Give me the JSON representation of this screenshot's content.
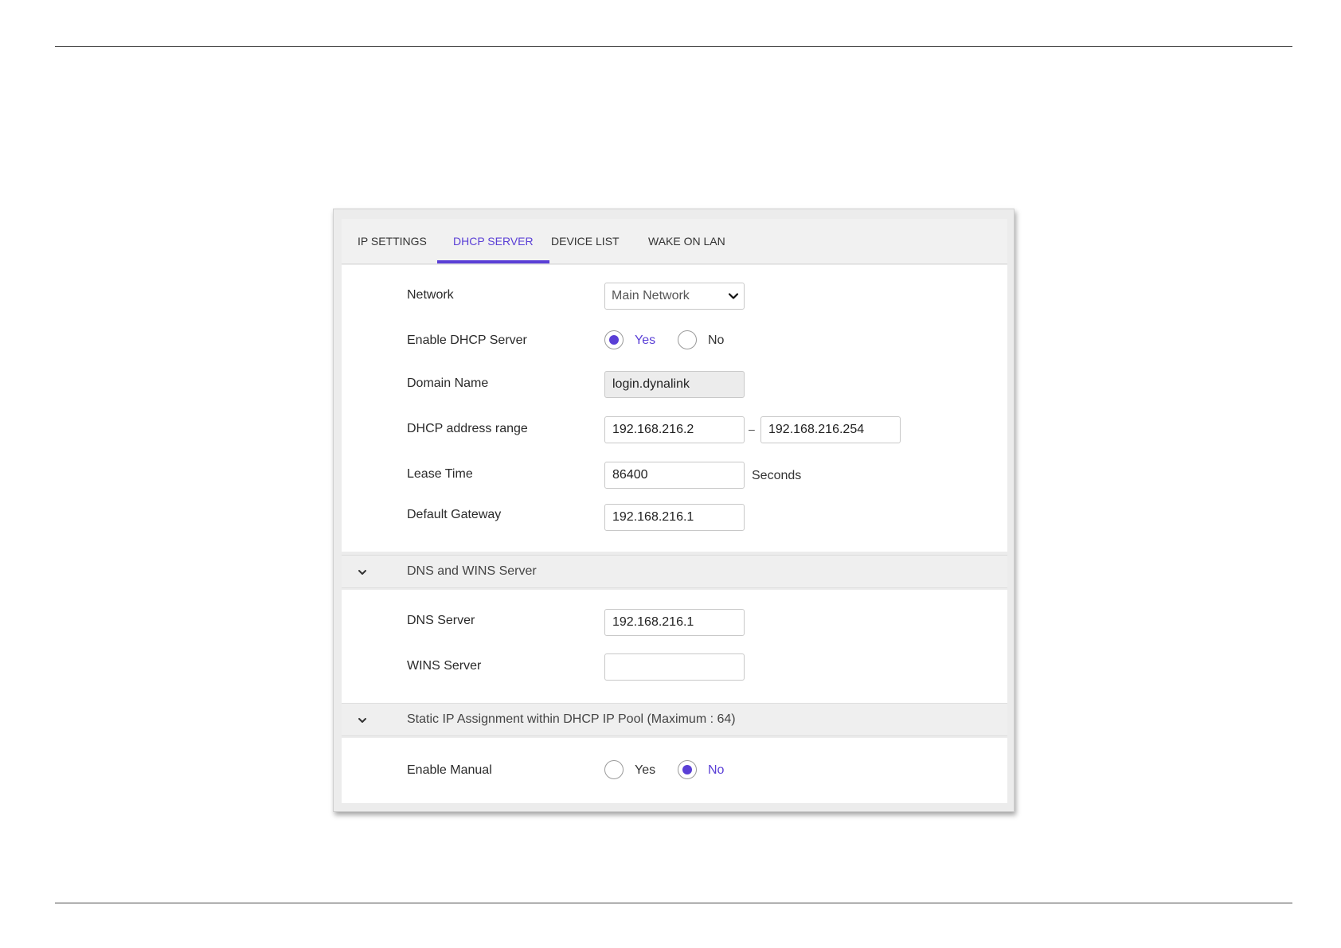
{
  "accent_color": "#5a3fd6",
  "tabs": [
    {
      "label": "IP SETTINGS",
      "active": false
    },
    {
      "label": "DHCP SERVER",
      "active": true
    },
    {
      "label": "DEVICE LIST",
      "active": false
    },
    {
      "label": "WAKE ON LAN",
      "active": false
    }
  ],
  "dhcp": {
    "network_label": "Network",
    "network_value": "Main Network",
    "enable_label": "Enable DHCP Server",
    "enable_yes": "Yes",
    "enable_no": "No",
    "enable_selected": "Yes",
    "domain_label": "Domain Name",
    "domain_value": "login.dynalink",
    "range_label": "DHCP address range",
    "range_start": "192.168.216.2",
    "range_separator": "–",
    "range_end": "192.168.216.254",
    "lease_label": "Lease Time",
    "lease_value": "86400",
    "lease_unit": "Seconds",
    "gateway_label": "Default Gateway",
    "gateway_value": "192.168.216.1"
  },
  "dns_group": {
    "title": "DNS and WINS Server",
    "icon": "chevron-down-icon",
    "dns_label": "DNS Server",
    "dns_value": "192.168.216.1",
    "wins_label": "WINS Server",
    "wins_value": ""
  },
  "static_group": {
    "title": "Static IP Assignment within DHCP IP Pool (Maximum : 64)",
    "icon": "chevron-down-icon",
    "manual_label": "Enable Manual",
    "manual_yes": "Yes",
    "manual_no": "No",
    "manual_selected": "No"
  }
}
